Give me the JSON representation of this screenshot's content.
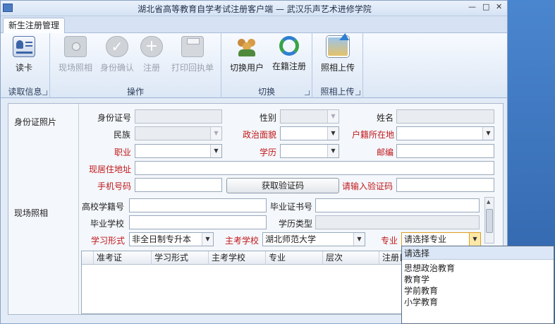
{
  "window": {
    "title": "湖北省高等教育自学考试注册客户端 — 武汉乐声艺术进修学院"
  },
  "tabs": [
    {
      "label": "新生注册管理"
    }
  ],
  "ribbon": {
    "groups": [
      {
        "label": "读取信息",
        "buttons": [
          {
            "label": "读卡",
            "icon": "id-card-icon",
            "enabled": true
          }
        ]
      },
      {
        "label": "操作",
        "buttons": [
          {
            "label": "现场照相",
            "icon": "camera-icon",
            "enabled": false
          },
          {
            "label": "身份确认",
            "icon": "check-icon",
            "enabled": false
          },
          {
            "label": "注册",
            "icon": "plus-icon",
            "enabled": false
          },
          {
            "label": "打印回执单",
            "icon": "printer-icon",
            "enabled": false
          }
        ]
      },
      {
        "label": "切换",
        "buttons": [
          {
            "label": "切换用户",
            "icon": "users-icon",
            "enabled": true
          },
          {
            "label": "在籍注册",
            "icon": "refresh-icon",
            "enabled": true
          }
        ]
      },
      {
        "label": "照相上传",
        "buttons": [
          {
            "label": "照相上传",
            "icon": "photo-upload-icon",
            "enabled": true
          }
        ]
      }
    ]
  },
  "form": {
    "id_photo_label": "身份证照片",
    "live_photo_label": "现场照相",
    "id_number": {
      "label": "身份证号",
      "value": ""
    },
    "gender": {
      "label": "性别",
      "value": ""
    },
    "name": {
      "label": "姓名",
      "value": ""
    },
    "ethnicity": {
      "label": "民族",
      "value": ""
    },
    "political_status": {
      "label": "政治面貌",
      "value": ""
    },
    "household": {
      "label": "户籍所在地",
      "value": ""
    },
    "occupation": {
      "label": "职业",
      "value": ""
    },
    "education": {
      "label": "学历",
      "value": ""
    },
    "postcode": {
      "label": "邮编",
      "value": ""
    },
    "address": {
      "label": "现居住地址",
      "value": ""
    },
    "phone": {
      "label": "手机号码",
      "value": ""
    },
    "get_code_button": "获取验证码",
    "verify_code": {
      "label": "请输入验证码",
      "value": ""
    },
    "school_roll": {
      "label": "高校学籍号",
      "value": ""
    },
    "diploma_no": {
      "label": "毕业证书号",
      "value": ""
    },
    "grad_school": {
      "label": "毕业学校",
      "value": ""
    },
    "edu_type": {
      "label": "学历类型",
      "value": ""
    },
    "study_form": {
      "label": "学习形式",
      "value": "非全日制专升本"
    },
    "host_school": {
      "label": "主考学校",
      "value": "湖北师范大学"
    },
    "major": {
      "label": "专业",
      "value": "请选择专业"
    }
  },
  "table": {
    "columns": [
      "",
      "准考证",
      "学习形式",
      "主考学校",
      "专业",
      "层次",
      "注册日"
    ]
  },
  "major_dropdown": {
    "options": [
      "请选择",
      "思想政治教育",
      "教育学",
      "学前教育",
      "小学教育"
    ],
    "highlighted_index": 0
  },
  "colors": {
    "required_label": "#c0181b",
    "accent": "#4c7cc4"
  }
}
